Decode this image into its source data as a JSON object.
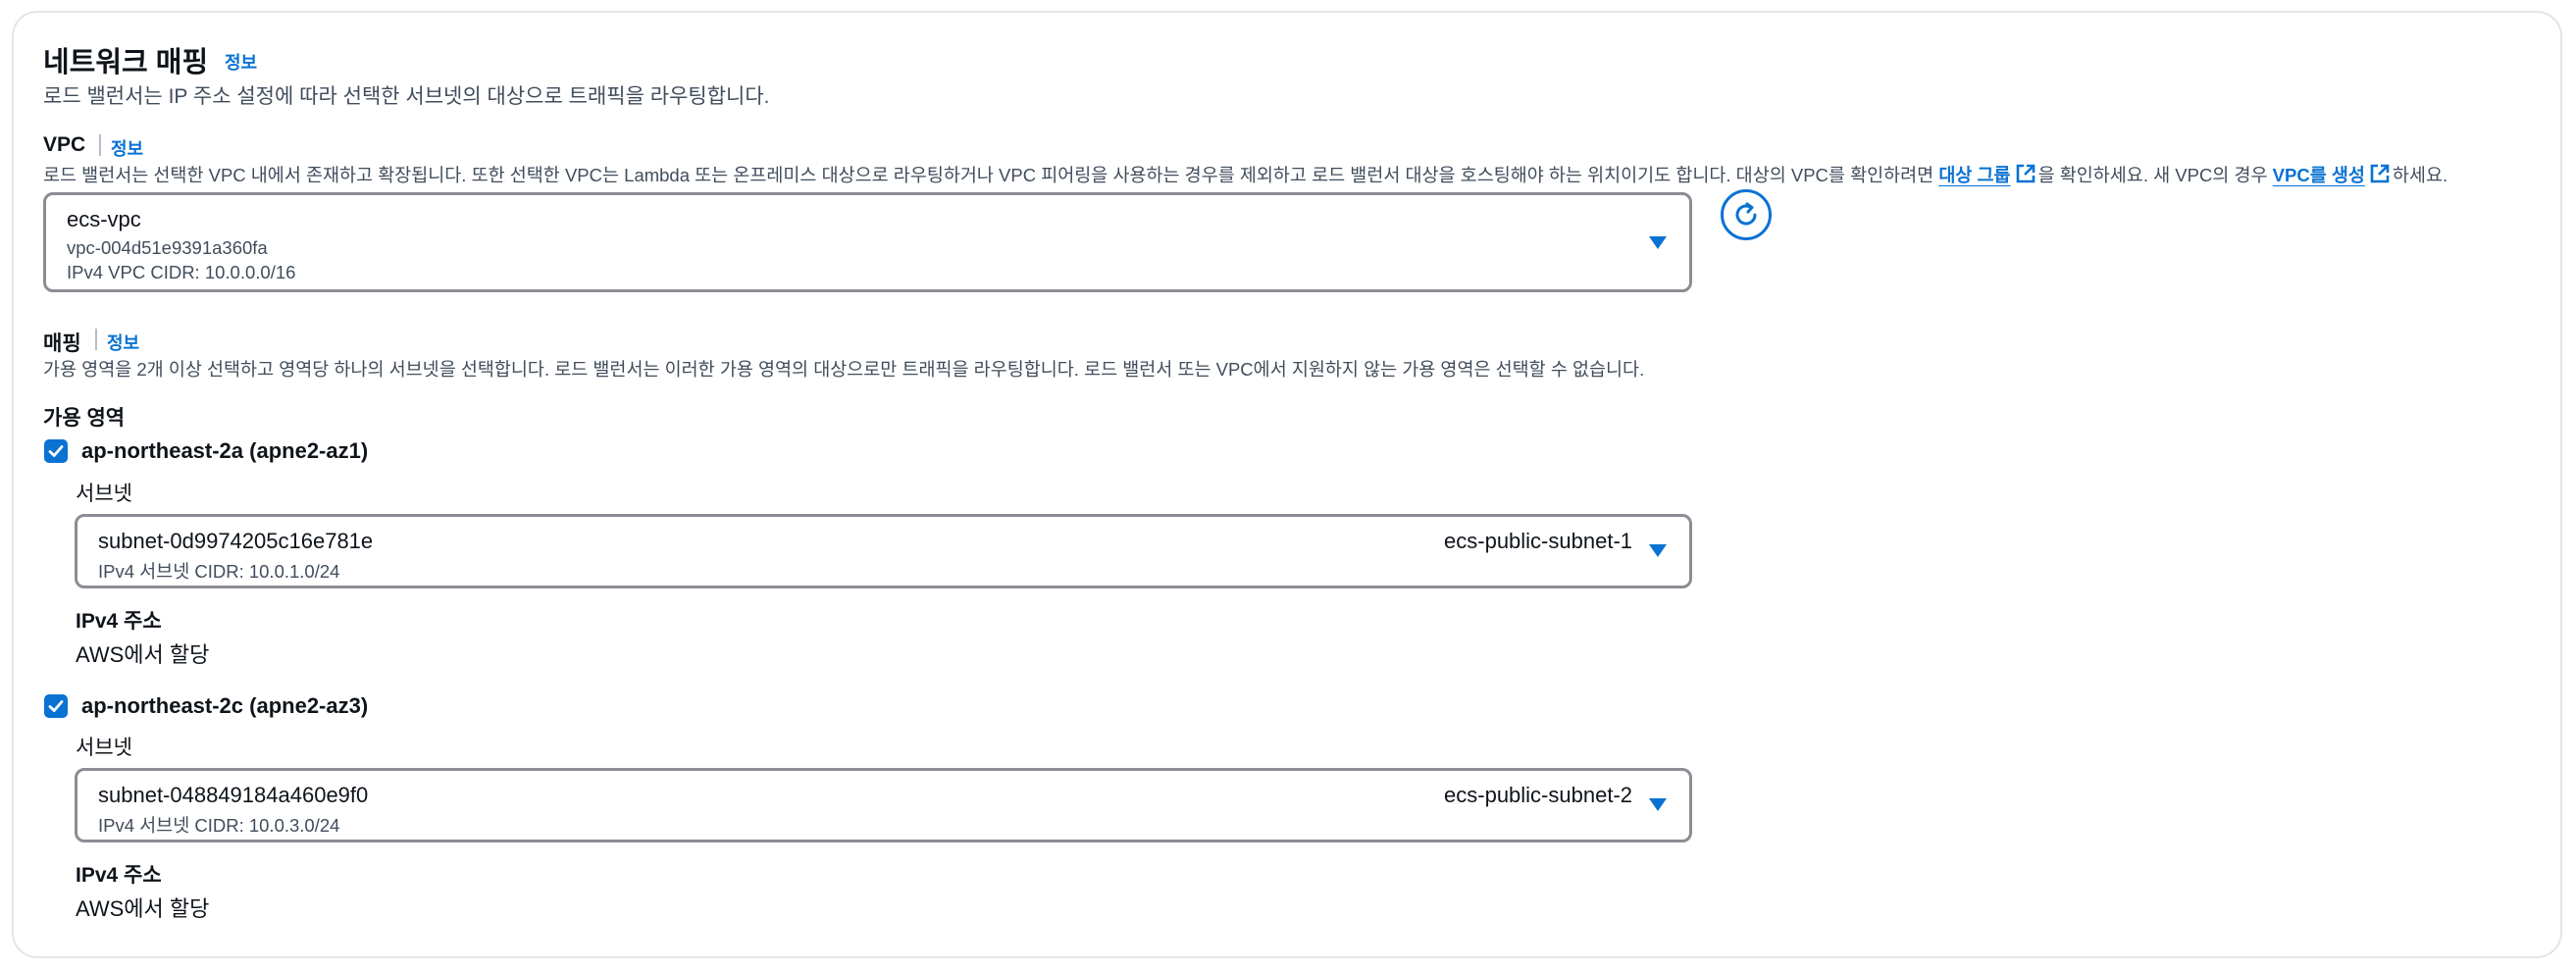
{
  "section": {
    "title": "네트워크 매핑",
    "info": "정보",
    "description": "로드 밸런서는 IP 주소 설정에 따라 선택한 서브넷의 대상으로 트래픽을 라우팅합니다."
  },
  "vpc": {
    "label": "VPC",
    "info": "정보",
    "description_pre": "로드 밸런서는 선택한 VPC 내에서 존재하고 확장됩니다. 또한 선택한 VPC는 Lambda 또는 온프레미스 대상으로 라우팅하거나 VPC 피어링을 사용하는 경우를 제외하고 로드 밸런서 대상을 호스팅해야 하는 위치이기도 합니다. 대상의 VPC를 확인하려면 ",
    "target_group_link": "대상 그룹",
    "description_mid": "을 확인하세요. 새 VPC의 경우 ",
    "create_vpc_link": "VPC를 생성",
    "description_post": "하세요.",
    "selected": {
      "name": "ecs-vpc",
      "id": "vpc-004d51e9391a360fa",
      "cidr": "IPv4 VPC CIDR: 10.0.0.0/16"
    }
  },
  "mapping": {
    "label": "매핑",
    "info": "정보",
    "description": "가용 영역을 2개 이상 선택하고 영역당 하나의 서브넷을 선택합니다. 로드 밸런서는 이러한 가용 영역의 대상으로만 트래픽을 라우팅합니다. 로드 밸런서 또는 VPC에서 지원하지 않는 가용 영역은 선택할 수 없습니다.",
    "az_heading": "가용 영역",
    "zones": [
      {
        "name": "ap-northeast-2a (apne2-az1)",
        "checked": true,
        "subnet_label": "서브넷",
        "subnet_id": "subnet-0d9974205c16e781e",
        "subnet_name": "ecs-public-subnet-1",
        "subnet_cidr": "IPv4 서브넷 CIDR: 10.0.1.0/24",
        "ipv4_label": "IPv4 주소",
        "ipv4_value": "AWS에서 할당"
      },
      {
        "name": "ap-northeast-2c (apne2-az3)",
        "checked": true,
        "subnet_label": "서브넷",
        "subnet_id": "subnet-048849184a460e9f0",
        "subnet_name": "ecs-public-subnet-2",
        "subnet_cidr": "IPv4 서브넷 CIDR: 10.0.3.0/24",
        "ipv4_label": "IPv4 주소",
        "ipv4_value": "AWS에서 할당"
      }
    ]
  },
  "colors": {
    "accent": "#0972d3",
    "border": "#8c8c94",
    "text": "#0f141a",
    "secondary_text": "#414d5c"
  }
}
